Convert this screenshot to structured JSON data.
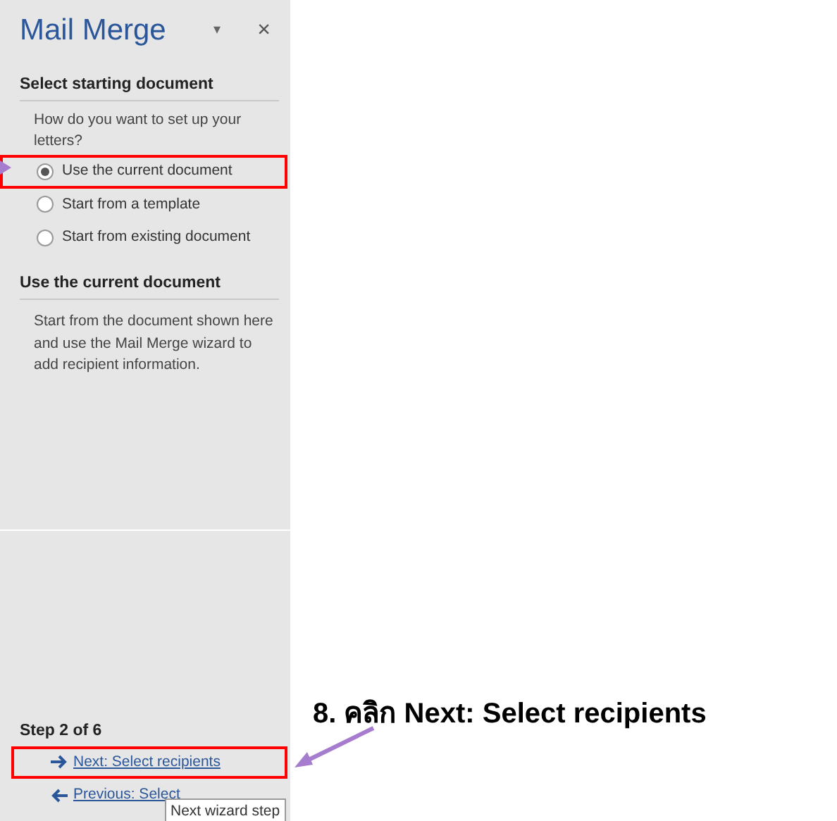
{
  "pane": {
    "title": "Mail Merge",
    "menu_glyph": "▾",
    "close_glyph": "×",
    "section_1": {
      "heading": "Select starting document",
      "question": "How do you want to set up your letters?",
      "options": [
        {
          "label": "Use the current document",
          "selected": true,
          "highlighted": true
        },
        {
          "label": "Start from a template",
          "selected": false,
          "highlighted": false
        },
        {
          "label": "Start from existing document",
          "selected": false,
          "highlighted": false
        }
      ]
    },
    "section_2": {
      "heading": "Use the current document",
      "text": "Start from the document shown here and use the Mail Merge wizard to add recipient information."
    },
    "step": "Step 2 of 6",
    "links": [
      {
        "kind": "next",
        "label": "Next: Select recipients",
        "highlighted": true
      },
      {
        "kind": "previous",
        "label": "Previous: Select",
        "highlighted": false
      }
    ],
    "tooltip": "Next wizard step"
  },
  "callout": {
    "text": "8. คลิก Next: Select recipients"
  }
}
